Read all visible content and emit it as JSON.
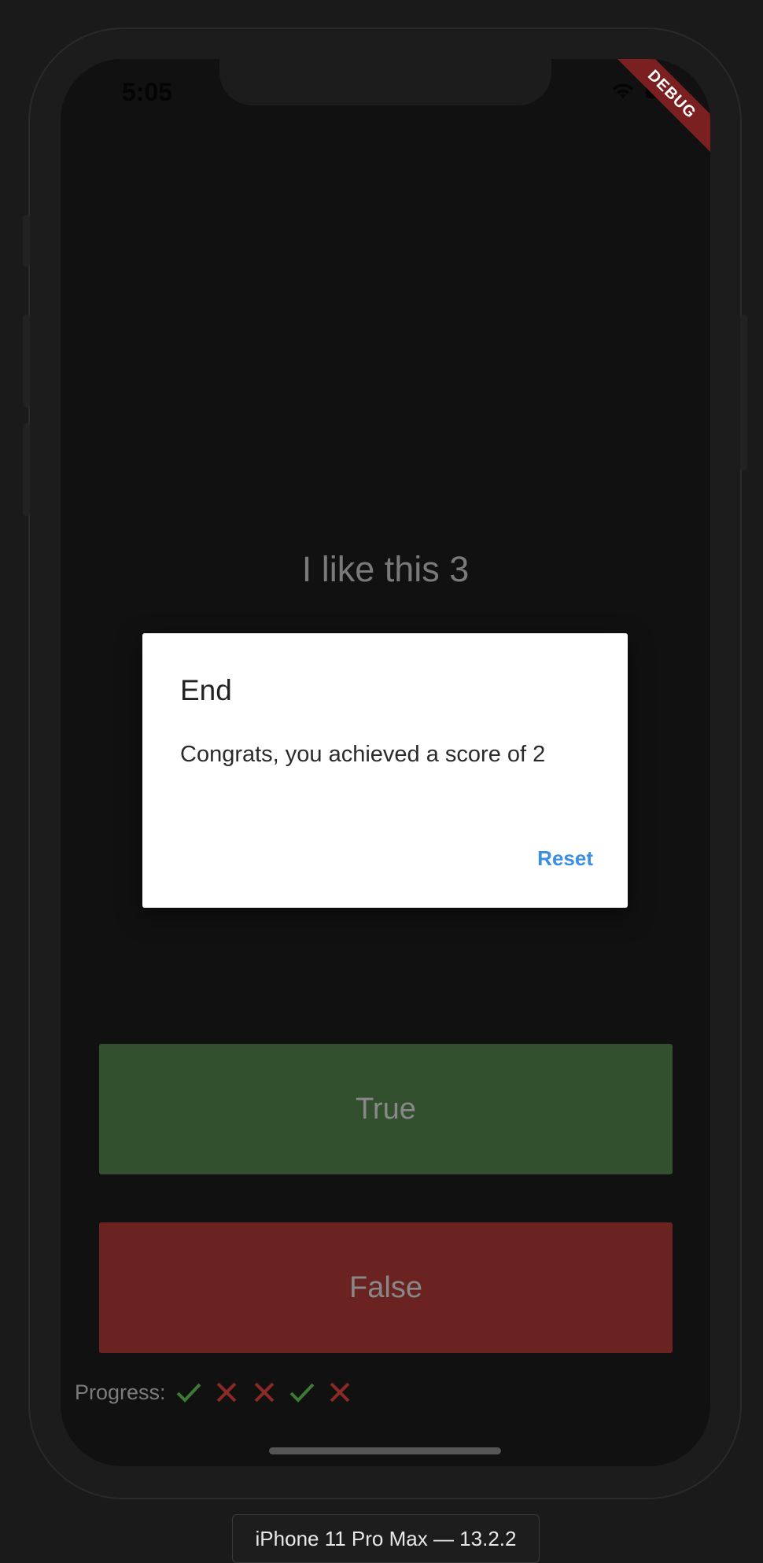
{
  "status_bar": {
    "time": "5:05"
  },
  "debug_banner": "DEBUG",
  "quiz": {
    "question": "I like this 3",
    "true_label": "True",
    "false_label": "False",
    "progress_label": "Progress:",
    "progress_marks": [
      "check",
      "cross",
      "cross",
      "check",
      "cross"
    ]
  },
  "dialog": {
    "title": "End",
    "message": "Congrats, you achieved a score of 2",
    "action_label": "Reset"
  },
  "device_label": "iPhone 11 Pro Max — 13.2.2",
  "colors": {
    "true_button": "#32502e",
    "false_button": "#6a2320",
    "check": "#3d7a36",
    "cross": "#8a2a26",
    "accent": "#3c8ee0"
  }
}
